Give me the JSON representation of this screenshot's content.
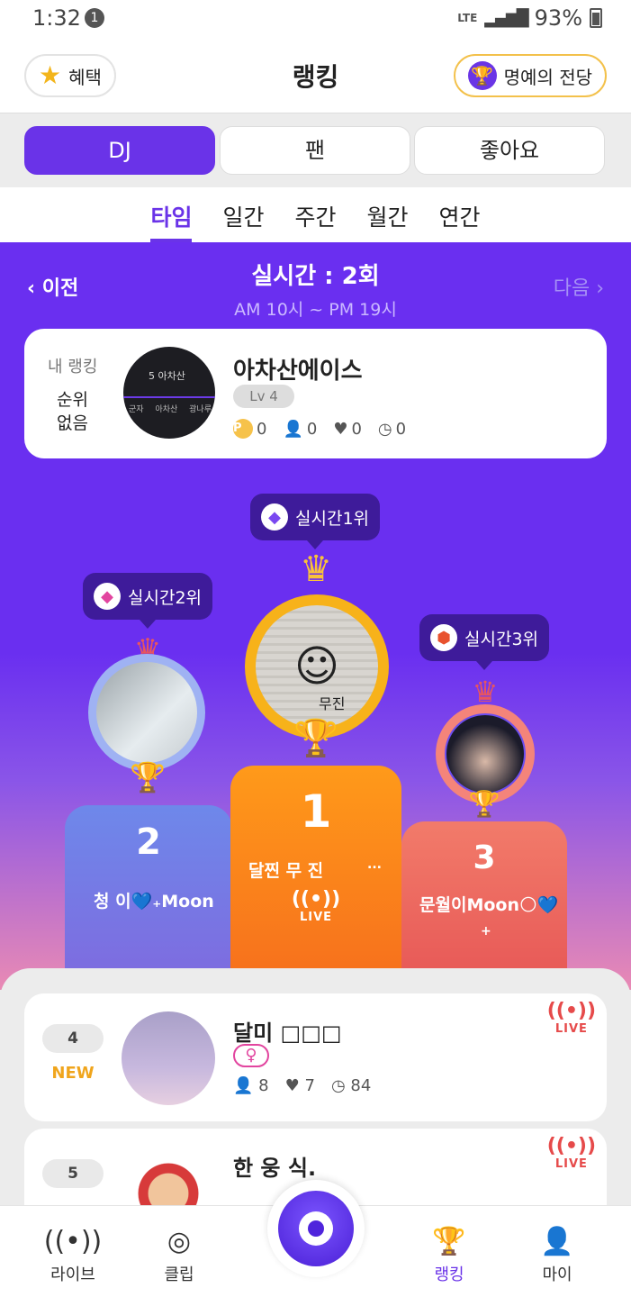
{
  "status": {
    "time": "1:32",
    "notif_count": "1",
    "network": "LTE",
    "battery": "93%"
  },
  "header": {
    "title": "랭킹",
    "benefit_label": "혜택",
    "hall_label": "명예의 전당"
  },
  "segments": [
    "DJ",
    "팬",
    "좋아요"
  ],
  "periods": [
    "타임",
    "일간",
    "주간",
    "월간",
    "연간"
  ],
  "period_nav": {
    "prev": "이전",
    "next": "다음",
    "title": "실시간 : 2회",
    "range": "AM 10시 ~ PM 19시"
  },
  "my_ranking": {
    "label": "내 랭킹",
    "rank_line1": "순위",
    "rank_line2": "없음",
    "name": "아차산에이스",
    "level": "Lv 4",
    "avatar_top": "5 아차산",
    "avatar_left": "군자",
    "avatar_mid": "아차산",
    "avatar_right": "광나루",
    "points": "0",
    "fans": "0",
    "likes": "0",
    "time": "0"
  },
  "podium": {
    "first": {
      "badge": "실시간1위",
      "name": "달찐 무 진",
      "extra": "...",
      "live": "LIVE",
      "rank": "1",
      "avatar_text": "무진"
    },
    "second": {
      "badge": "실시간2위",
      "name": "청 이💙₊Moon",
      "rank": "2"
    },
    "third": {
      "badge": "실시간3위",
      "name": "문월이Moon🌕💙",
      "sub": "+",
      "rank": "3"
    }
  },
  "list": [
    {
      "rank": "4",
      "status": "NEW",
      "name": "달미 □□□",
      "gender": "♀",
      "fans": "8",
      "likes": "7",
      "time": "84",
      "live": "LIVE"
    },
    {
      "rank": "5",
      "name": "한 웅 식.",
      "live": "LIVE"
    }
  ],
  "tabbar": {
    "live": "라이브",
    "clip": "클립",
    "ranking": "랭킹",
    "my": "마이"
  },
  "colors": {
    "accent": "#6a33e8",
    "gold": "#f9c23a",
    "live": "#e64a4a"
  }
}
